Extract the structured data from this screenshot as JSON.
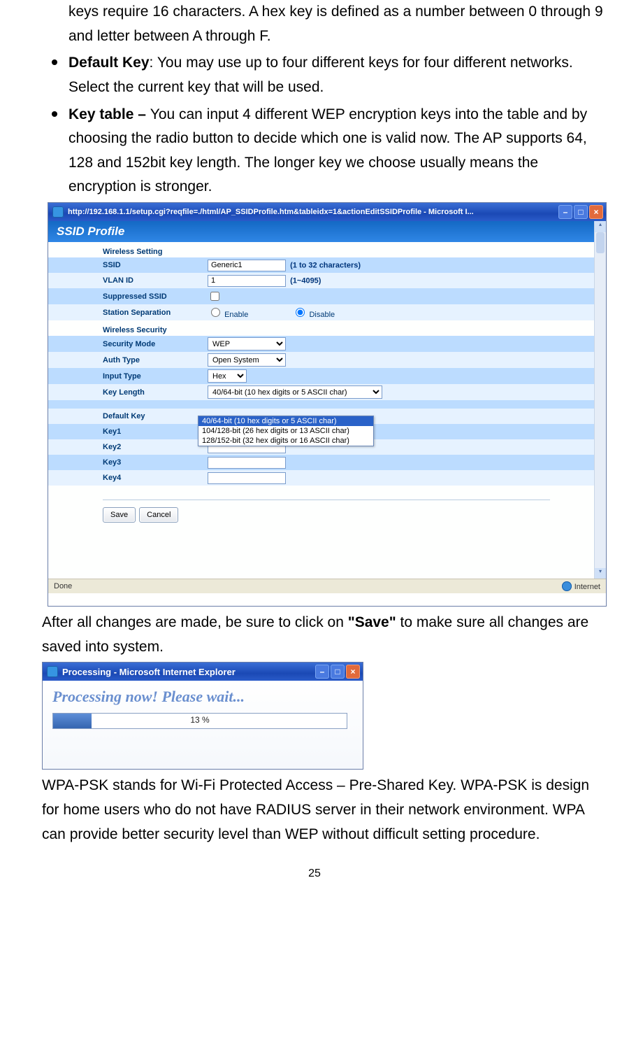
{
  "para_top": "keys require 16 characters. A hex key is defined as a number between 0 through 9 and letter between A through F.",
  "bullet_default_key_label": "Default Key",
  "bullet_default_key_rest": ": You may use up to four different keys for four different networks. Select the current key that will be used.",
  "bullet_keytable_label": "Key table – ",
  "bullet_keytable_rest": "You can input 4 different WEP encryption keys into the table and by choosing the radio button to decide which one is valid now. The AP supports 64, 128 and 152bit key length. The longer key we choose usually means the encryption is stronger.",
  "ie1": {
    "title": "http://192.168.1.1/setup.cgi?reqfile=./html/AP_SSIDProfile.htm&tableidx=1&actionEditSSIDProfile - Microsoft I...",
    "header": "SSID Profile",
    "section1": "Wireless Setting",
    "ssid_lbl": "SSID",
    "ssid_val": "Generic1",
    "ssid_hint": "(1 to 32 characters)",
    "vlan_lbl": "VLAN ID",
    "vlan_val": "1",
    "vlan_hint": "(1~4095)",
    "supp_lbl": "Suppressed SSID",
    "sep_lbl": "Station Separation",
    "enable": "Enable",
    "disable": "Disable",
    "section2": "Wireless Security",
    "secmode_lbl": "Security Mode",
    "secmode_val": "WEP",
    "auth_lbl": "Auth Type",
    "auth_val": "Open System",
    "input_lbl": "Input Type",
    "input_val": "Hex",
    "keylen_lbl": "Key Length",
    "keylen_sel": "40/64-bit (10 hex digits or 5 ASCII char)",
    "keylen_opts": {
      "a": "40/64-bit (10 hex digits or 5 ASCII char)",
      "b": "104/128-bit (26 hex digits or 13 ASCII char)",
      "c": "128/152-bit (32 hex digits or 16 ASCII char)"
    },
    "defkey_lbl": "Default Key",
    "key1": "Key1",
    "key2": "Key2",
    "key3": "Key3",
    "key4": "Key4",
    "save": "Save",
    "cancel": "Cancel",
    "status_done": "Done",
    "status_zone": "Internet"
  },
  "para_after1_pre": "After all changes are made, be sure to click on ",
  "para_after1_b": "\"Save\"",
  "para_after1_post": " to make sure all changes are saved into system.",
  "ie2": {
    "title": "Processing - Microsoft Internet Explorer",
    "msg": "Processing now! Please wait...",
    "pct": "13 %"
  },
  "para_wpa": "WPA-PSK stands for Wi-Fi Protected Access – Pre-Shared Key. WPA-PSK is design for home users who do not have RADIUS server in their network environment. WPA can provide better security level than WEP without difficult setting procedure.",
  "page_number": "25"
}
